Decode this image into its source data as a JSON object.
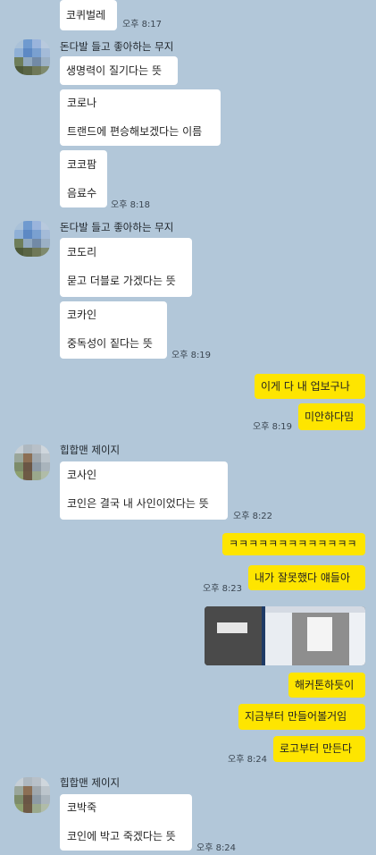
{
  "chat": {
    "m0": {
      "text": "코퀴벌레",
      "time": "오후 8:17"
    },
    "g1": {
      "sender": "돈다발 들고 좋아하는 무지",
      "m1": "생명력이 질기다는 뜻",
      "m2a": "코로나",
      "m2b": "트랜드에 편승해보겠다는 이름",
      "m3a": "코코팜",
      "m3b": "음료수",
      "time": "오후 8:18"
    },
    "g2": {
      "sender": "돈다발 들고 좋아하는 무지",
      "m1a": "코도리",
      "m1b": "묻고 더블로 가겠다는 뜻",
      "m2a": "코카인",
      "m2b": "중독성이 짙다는 뜻",
      "time": "오후 8:19"
    },
    "o1": {
      "m1": "이게 다 내 업보구나",
      "m2": "미안하다밈",
      "time": "오후 8:19"
    },
    "g3": {
      "sender": "힙합맨 제이지",
      "m1a": "코사인",
      "m1b": "코인은 결국 내 사인이었다는 뜻",
      "time": "오후 8:22"
    },
    "o2": {
      "m1": "ㅋㅋㅋㅋㅋㅋㅋㅋㅋㅋㅋㅋㅋ",
      "m2": "내가 잘못했다 얘들아",
      "time": "오후 8:23",
      "m3": "해커톤하듯이",
      "m4": "지금부터 만들어볼거임",
      "m5": "로고부터 만든다",
      "time2": "오후 8:24"
    },
    "g4": {
      "sender": "힙합맨 제이지",
      "m1a": "코박죽",
      "m1b": "코인에 박고 죽겠다는 뜻",
      "time": "오후 8:24"
    }
  }
}
